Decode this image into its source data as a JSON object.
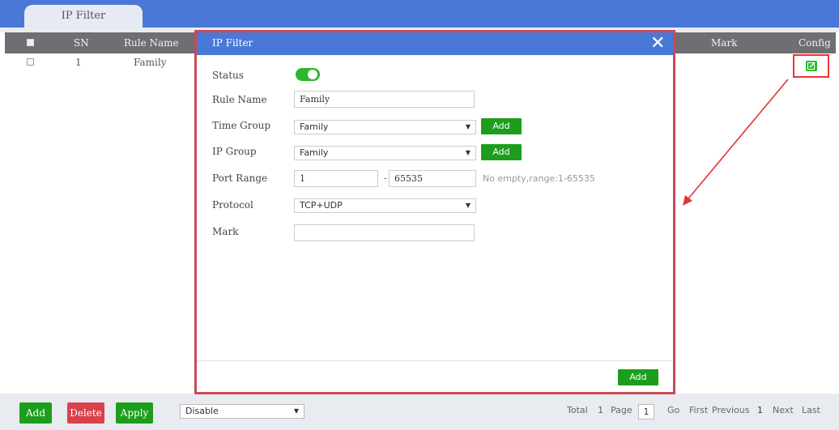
{
  "header": {
    "tab_label": "IP Filter"
  },
  "table": {
    "columns": {
      "sn": "SN",
      "rule_name": "Rule Name",
      "mark": "Mark",
      "config": "Config"
    },
    "rows": [
      {
        "sn": "1",
        "rule_name": "Family"
      }
    ]
  },
  "modal": {
    "title": "IP Filter",
    "close_glyph": "✕",
    "fields": {
      "status_label": "Status",
      "status_on": true,
      "rule_name_label": "Rule Name",
      "rule_name_value": "Family",
      "time_group_label": "Time Group",
      "time_group_value": "Family",
      "ip_group_label": "IP Group",
      "ip_group_value": "Family",
      "port_range_label": "Port Range",
      "port_from": "1",
      "port_sep": "-",
      "port_to": "65535",
      "port_hint": "No empty,range:1-65535",
      "protocol_label": "Protocol",
      "protocol_value": "TCP+UDP",
      "mark_label": "Mark",
      "mark_value": ""
    },
    "add_inline_label": "Add",
    "submit_label": "Add"
  },
  "footer": {
    "add_label": "Add",
    "delete_label": "Delete",
    "apply_label": "Apply",
    "action_select_value": "Disable",
    "pager": {
      "total_label": "Total",
      "total_value": "1",
      "page_label": "Page",
      "page_value": "1",
      "go_label": "Go",
      "first_label": "First",
      "previous_label": "Previous",
      "current_value": "1",
      "next_label": "Next",
      "last_label": "Last"
    }
  },
  "colors": {
    "accent_blue": "#4a78d6",
    "green": "#1c9e1c",
    "red": "#d9424c",
    "highlight": "#e33333"
  },
  "icons": [
    "close-icon",
    "edit-icon",
    "chevron-down-icon",
    "arrow-annotation"
  ]
}
